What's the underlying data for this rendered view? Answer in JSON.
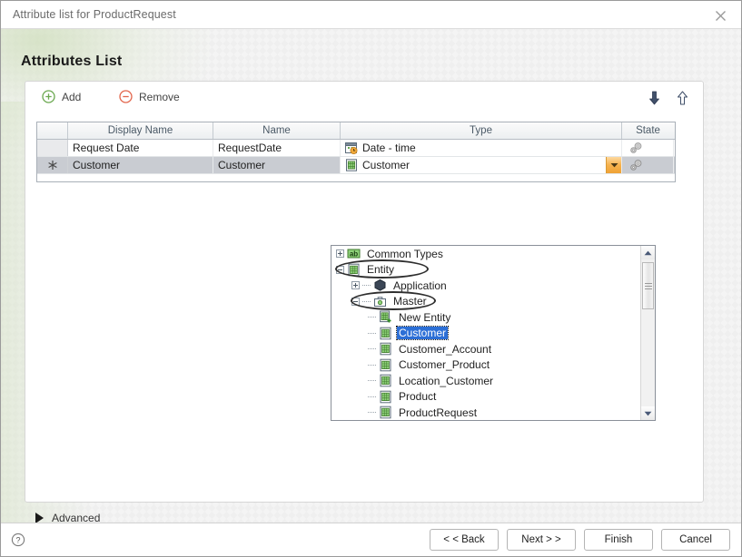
{
  "window": {
    "title": "Attribute list for ProductRequest",
    "close_icon": "close-icon"
  },
  "page": {
    "heading": "Attributes List"
  },
  "toolbar": {
    "add_label": "Add",
    "remove_label": "Remove",
    "add_icon": "plus-circle-icon",
    "remove_icon": "minus-circle-icon",
    "move_down_icon": "arrow-down-icon",
    "move_up_icon": "arrow-up-icon"
  },
  "grid": {
    "columns": [
      "",
      "Display Name",
      "Name",
      "Type",
      "State"
    ],
    "rows": [
      {
        "selector": "",
        "display_name": "Request Date",
        "name": "RequestDate",
        "type": "Date - time",
        "type_icon": "calendar-clock-icon",
        "state_icon": "gears-icon",
        "selected": false,
        "dropdown_open": false
      },
      {
        "selector": "new-row-asterisk",
        "display_name": "Customer",
        "name": "Customer",
        "type": "Customer",
        "type_icon": "entity-grid-icon",
        "state_icon": "gears-icon",
        "selected": true,
        "dropdown_open": true
      }
    ]
  },
  "type_tree": {
    "nodes": [
      {
        "label": "Common Types",
        "depth": 0,
        "toggle": "plus",
        "icon": "ab-text-icon",
        "selected": false,
        "annotated": false
      },
      {
        "label": "Entity",
        "depth": 0,
        "toggle": "minus",
        "icon": "entity-grid-icon",
        "selected": false,
        "annotated": true
      },
      {
        "label": "Application",
        "depth": 1,
        "toggle": "plus",
        "icon": "hexagon-icon",
        "selected": false,
        "annotated": false
      },
      {
        "label": "Master",
        "depth": 1,
        "toggle": "minus",
        "icon": "briefcase-icon",
        "selected": false,
        "annotated": true
      },
      {
        "label": "New Entity",
        "depth": 2,
        "toggle": "none",
        "icon": "new-entity-icon",
        "selected": false,
        "annotated": false
      },
      {
        "label": "Customer",
        "depth": 2,
        "toggle": "none",
        "icon": "entity-grid-icon",
        "selected": true,
        "annotated": false
      },
      {
        "label": "Customer_Account",
        "depth": 2,
        "toggle": "none",
        "icon": "entity-grid-icon",
        "selected": false,
        "annotated": false
      },
      {
        "label": "Customer_Product",
        "depth": 2,
        "toggle": "none",
        "icon": "entity-grid-icon",
        "selected": false,
        "annotated": false
      },
      {
        "label": "Location_Customer",
        "depth": 2,
        "toggle": "none",
        "icon": "entity-grid-icon",
        "selected": false,
        "annotated": false
      },
      {
        "label": "Product",
        "depth": 2,
        "toggle": "none",
        "icon": "entity-grid-icon",
        "selected": false,
        "annotated": false
      },
      {
        "label": "ProductRequest",
        "depth": 2,
        "toggle": "none",
        "icon": "entity-grid-icon",
        "selected": false,
        "annotated": false
      }
    ],
    "scrollbar": {
      "up_icon": "scroll-up-icon",
      "down_icon": "scroll-down-icon"
    }
  },
  "advanced": {
    "label": "Advanced",
    "icon": "triangle-right-icon",
    "expanded": false
  },
  "footer": {
    "help_icon": "help-icon",
    "buttons": [
      {
        "label": "< < Back"
      },
      {
        "label": "Next > >"
      },
      {
        "label": "Finish"
      },
      {
        "label": "Cancel"
      }
    ]
  },
  "colors": {
    "accent_orange": "#efa235",
    "accent_green": "#6aa84f",
    "selection_blue": "#2c6fd6",
    "row_selected": "#c9ccd2"
  }
}
